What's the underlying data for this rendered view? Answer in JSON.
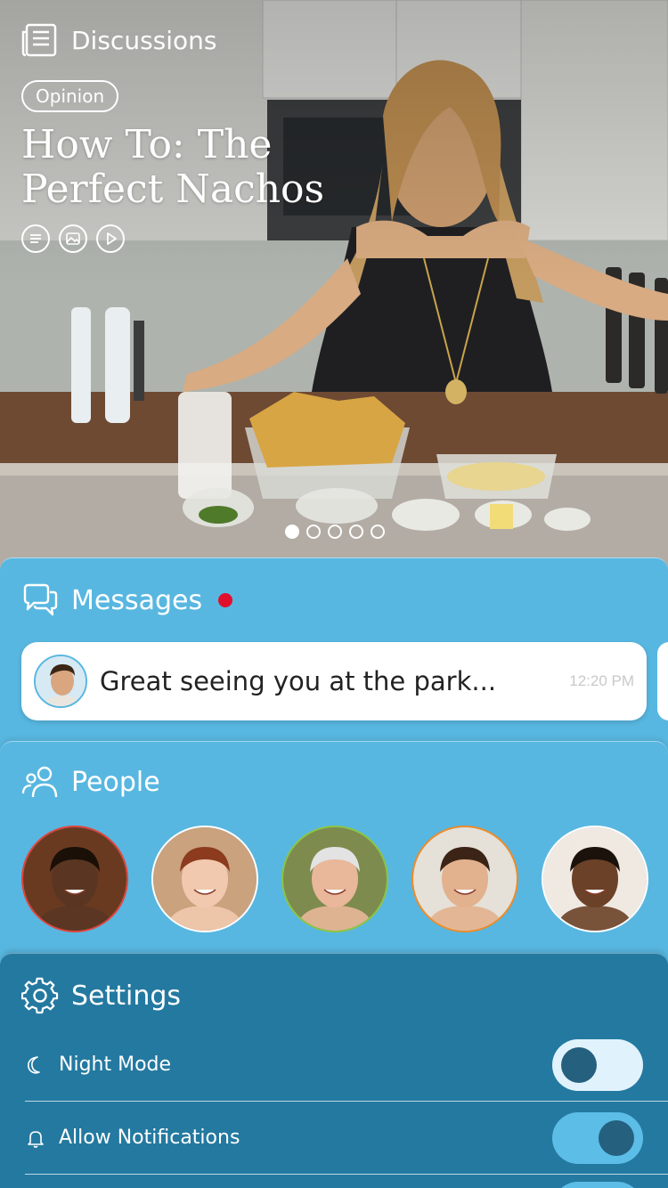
{
  "hero": {
    "section_title": "Discussions",
    "tag": "Opinion",
    "headline": "How To: The Perfect Nachos",
    "media_icons": [
      "article-icon",
      "gallery-icon",
      "play-icon"
    ],
    "carousel": {
      "count": 5,
      "active_index": 0
    }
  },
  "messages": {
    "title": "Messages",
    "has_unread": true,
    "preview": {
      "text": "Great seeing you at the park...",
      "time": "12:20 PM"
    }
  },
  "people": {
    "title": "People",
    "avatars": [
      {
        "ring": "#e2433b",
        "skin": "#5a3622",
        "hair": "#1a1008",
        "bg": "#6a3a20"
      },
      {
        "ring": "#ffffff",
        "skin": "#f1c9ae",
        "hair": "#8c3b1e",
        "bg": "#caa27e"
      },
      {
        "ring": "#8cc63f",
        "skin": "#e9b79a",
        "hair": "#e3e3e3",
        "bg": "#7e8b4e"
      },
      {
        "ring": "#f08a24",
        "skin": "#e2b18e",
        "hair": "#3b2415",
        "bg": "#e5e0d8"
      },
      {
        "ring": "#ffffff",
        "skin": "#6b4128",
        "hair": "#1b120c",
        "bg": "#f0e9e2"
      }
    ]
  },
  "settings": {
    "title": "Settings",
    "items": [
      {
        "label": "Night Mode",
        "icon": "moon-icon",
        "on": false
      },
      {
        "label": "Allow Notifications",
        "icon": "bell-icon",
        "on": true
      }
    ]
  },
  "colors": {
    "panel_blue": "#58b7e0",
    "settings_blue": "#2479a0",
    "unread": "#e0102d"
  }
}
